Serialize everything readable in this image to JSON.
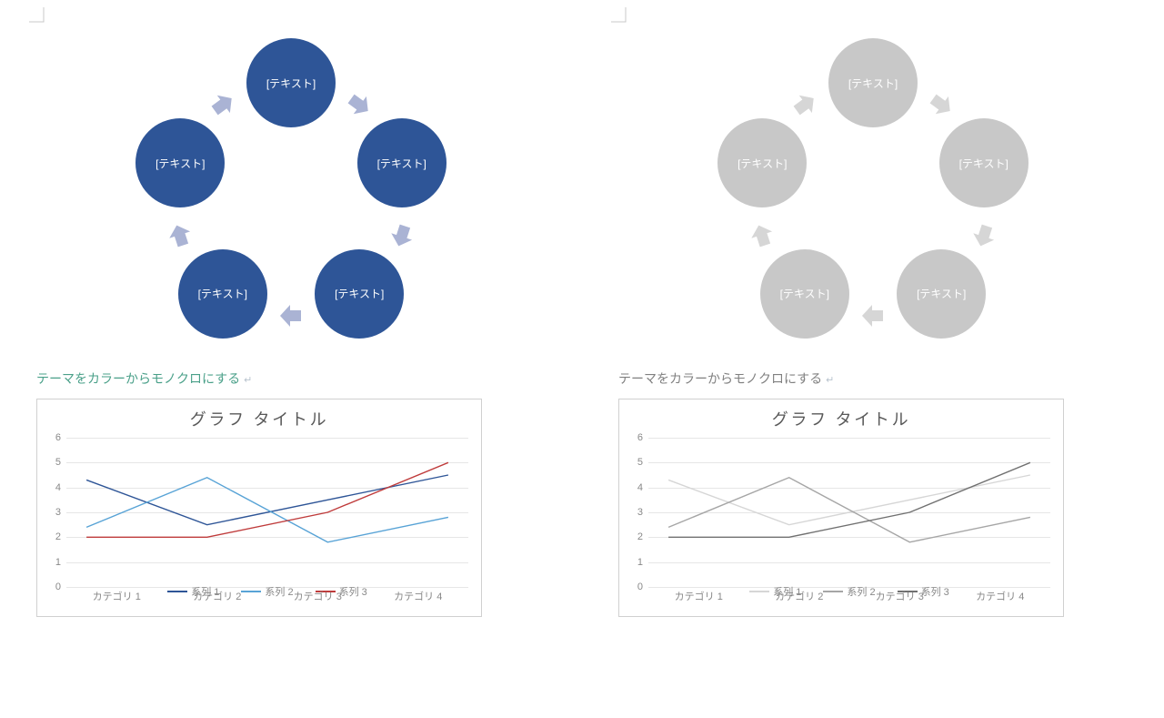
{
  "diagram": {
    "node_label": "[テキスト]",
    "caption": "テーマをカラーからモノクロにする",
    "color_node": "#2e5597",
    "color_arrow": "#aab3d4",
    "mono_node": "#c8c8c8",
    "mono_arrow": "#d6d6d6",
    "caption_color_left": "#4aa089",
    "caption_color_right": "#808080"
  },
  "chart_data": {
    "type": "line",
    "title": "グラフ タイトル",
    "ylim": [
      0,
      6
    ],
    "yticks": [
      0,
      1,
      2,
      3,
      4,
      5,
      6
    ],
    "categories": [
      "カテゴリ 1",
      "カテゴリ 2",
      "カテゴリ 3",
      "カテゴリ 4"
    ],
    "series": [
      {
        "name": "系列 1",
        "values": [
          4.3,
          2.5,
          3.5,
          4.5
        ]
      },
      {
        "name": "系列 2",
        "values": [
          2.4,
          4.4,
          1.8,
          2.8
        ]
      },
      {
        "name": "系列 3",
        "values": [
          2.0,
          2.0,
          3.0,
          5.0
        ]
      }
    ],
    "colors_left": [
      "#2e5597",
      "#58a3d6",
      "#bf3b3b"
    ],
    "colors_right": [
      "#d6d6d6",
      "#a6a6a6",
      "#707070"
    ]
  }
}
